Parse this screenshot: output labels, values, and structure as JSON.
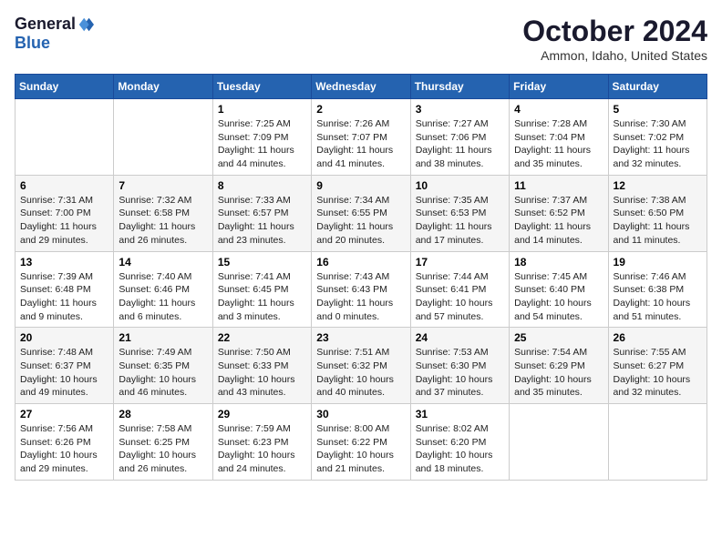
{
  "logo": {
    "general": "General",
    "blue": "Blue"
  },
  "title": "October 2024",
  "location": "Ammon, Idaho, United States",
  "days_of_week": [
    "Sunday",
    "Monday",
    "Tuesday",
    "Wednesday",
    "Thursday",
    "Friday",
    "Saturday"
  ],
  "weeks": [
    [
      {
        "day": "",
        "sunrise": "",
        "sunset": "",
        "daylight": ""
      },
      {
        "day": "",
        "sunrise": "",
        "sunset": "",
        "daylight": ""
      },
      {
        "day": "1",
        "sunrise": "Sunrise: 7:25 AM",
        "sunset": "Sunset: 7:09 PM",
        "daylight": "Daylight: 11 hours and 44 minutes."
      },
      {
        "day": "2",
        "sunrise": "Sunrise: 7:26 AM",
        "sunset": "Sunset: 7:07 PM",
        "daylight": "Daylight: 11 hours and 41 minutes."
      },
      {
        "day": "3",
        "sunrise": "Sunrise: 7:27 AM",
        "sunset": "Sunset: 7:06 PM",
        "daylight": "Daylight: 11 hours and 38 minutes."
      },
      {
        "day": "4",
        "sunrise": "Sunrise: 7:28 AM",
        "sunset": "Sunset: 7:04 PM",
        "daylight": "Daylight: 11 hours and 35 minutes."
      },
      {
        "day": "5",
        "sunrise": "Sunrise: 7:30 AM",
        "sunset": "Sunset: 7:02 PM",
        "daylight": "Daylight: 11 hours and 32 minutes."
      }
    ],
    [
      {
        "day": "6",
        "sunrise": "Sunrise: 7:31 AM",
        "sunset": "Sunset: 7:00 PM",
        "daylight": "Daylight: 11 hours and 29 minutes."
      },
      {
        "day": "7",
        "sunrise": "Sunrise: 7:32 AM",
        "sunset": "Sunset: 6:58 PM",
        "daylight": "Daylight: 11 hours and 26 minutes."
      },
      {
        "day": "8",
        "sunrise": "Sunrise: 7:33 AM",
        "sunset": "Sunset: 6:57 PM",
        "daylight": "Daylight: 11 hours and 23 minutes."
      },
      {
        "day": "9",
        "sunrise": "Sunrise: 7:34 AM",
        "sunset": "Sunset: 6:55 PM",
        "daylight": "Daylight: 11 hours and 20 minutes."
      },
      {
        "day": "10",
        "sunrise": "Sunrise: 7:35 AM",
        "sunset": "Sunset: 6:53 PM",
        "daylight": "Daylight: 11 hours and 17 minutes."
      },
      {
        "day": "11",
        "sunrise": "Sunrise: 7:37 AM",
        "sunset": "Sunset: 6:52 PM",
        "daylight": "Daylight: 11 hours and 14 minutes."
      },
      {
        "day": "12",
        "sunrise": "Sunrise: 7:38 AM",
        "sunset": "Sunset: 6:50 PM",
        "daylight": "Daylight: 11 hours and 11 minutes."
      }
    ],
    [
      {
        "day": "13",
        "sunrise": "Sunrise: 7:39 AM",
        "sunset": "Sunset: 6:48 PM",
        "daylight": "Daylight: 11 hours and 9 minutes."
      },
      {
        "day": "14",
        "sunrise": "Sunrise: 7:40 AM",
        "sunset": "Sunset: 6:46 PM",
        "daylight": "Daylight: 11 hours and 6 minutes."
      },
      {
        "day": "15",
        "sunrise": "Sunrise: 7:41 AM",
        "sunset": "Sunset: 6:45 PM",
        "daylight": "Daylight: 11 hours and 3 minutes."
      },
      {
        "day": "16",
        "sunrise": "Sunrise: 7:43 AM",
        "sunset": "Sunset: 6:43 PM",
        "daylight": "Daylight: 11 hours and 0 minutes."
      },
      {
        "day": "17",
        "sunrise": "Sunrise: 7:44 AM",
        "sunset": "Sunset: 6:41 PM",
        "daylight": "Daylight: 10 hours and 57 minutes."
      },
      {
        "day": "18",
        "sunrise": "Sunrise: 7:45 AM",
        "sunset": "Sunset: 6:40 PM",
        "daylight": "Daylight: 10 hours and 54 minutes."
      },
      {
        "day": "19",
        "sunrise": "Sunrise: 7:46 AM",
        "sunset": "Sunset: 6:38 PM",
        "daylight": "Daylight: 10 hours and 51 minutes."
      }
    ],
    [
      {
        "day": "20",
        "sunrise": "Sunrise: 7:48 AM",
        "sunset": "Sunset: 6:37 PM",
        "daylight": "Daylight: 10 hours and 49 minutes."
      },
      {
        "day": "21",
        "sunrise": "Sunrise: 7:49 AM",
        "sunset": "Sunset: 6:35 PM",
        "daylight": "Daylight: 10 hours and 46 minutes."
      },
      {
        "day": "22",
        "sunrise": "Sunrise: 7:50 AM",
        "sunset": "Sunset: 6:33 PM",
        "daylight": "Daylight: 10 hours and 43 minutes."
      },
      {
        "day": "23",
        "sunrise": "Sunrise: 7:51 AM",
        "sunset": "Sunset: 6:32 PM",
        "daylight": "Daylight: 10 hours and 40 minutes."
      },
      {
        "day": "24",
        "sunrise": "Sunrise: 7:53 AM",
        "sunset": "Sunset: 6:30 PM",
        "daylight": "Daylight: 10 hours and 37 minutes."
      },
      {
        "day": "25",
        "sunrise": "Sunrise: 7:54 AM",
        "sunset": "Sunset: 6:29 PM",
        "daylight": "Daylight: 10 hours and 35 minutes."
      },
      {
        "day": "26",
        "sunrise": "Sunrise: 7:55 AM",
        "sunset": "Sunset: 6:27 PM",
        "daylight": "Daylight: 10 hours and 32 minutes."
      }
    ],
    [
      {
        "day": "27",
        "sunrise": "Sunrise: 7:56 AM",
        "sunset": "Sunset: 6:26 PM",
        "daylight": "Daylight: 10 hours and 29 minutes."
      },
      {
        "day": "28",
        "sunrise": "Sunrise: 7:58 AM",
        "sunset": "Sunset: 6:25 PM",
        "daylight": "Daylight: 10 hours and 26 minutes."
      },
      {
        "day": "29",
        "sunrise": "Sunrise: 7:59 AM",
        "sunset": "Sunset: 6:23 PM",
        "daylight": "Daylight: 10 hours and 24 minutes."
      },
      {
        "day": "30",
        "sunrise": "Sunrise: 8:00 AM",
        "sunset": "Sunset: 6:22 PM",
        "daylight": "Daylight: 10 hours and 21 minutes."
      },
      {
        "day": "31",
        "sunrise": "Sunrise: 8:02 AM",
        "sunset": "Sunset: 6:20 PM",
        "daylight": "Daylight: 10 hours and 18 minutes."
      },
      {
        "day": "",
        "sunrise": "",
        "sunset": "",
        "daylight": ""
      },
      {
        "day": "",
        "sunrise": "",
        "sunset": "",
        "daylight": ""
      }
    ]
  ]
}
